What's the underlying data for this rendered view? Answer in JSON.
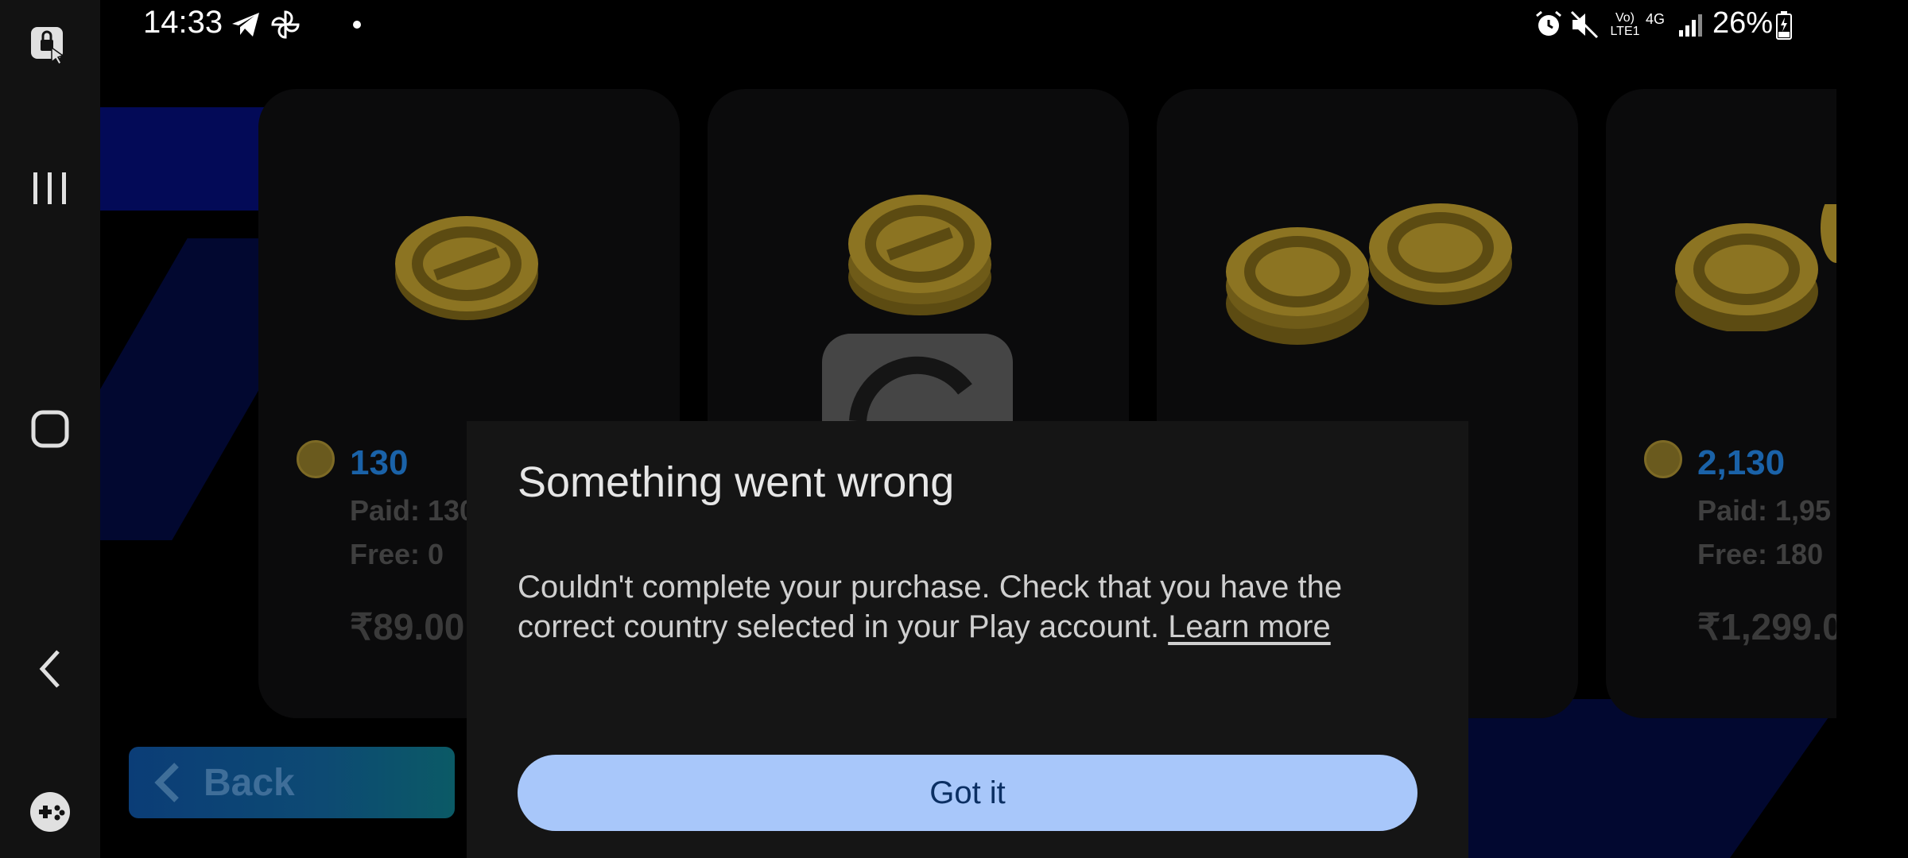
{
  "status_bar": {
    "time": "14:33",
    "battery": "26%",
    "network": "4G",
    "volte": "Vo) LTE1"
  },
  "nav_bar": {
    "icons": [
      "lock-touch-icon",
      "recents-icon",
      "home-icon",
      "back-arrow-icon",
      "game-launcher-icon"
    ]
  },
  "store": {
    "cards": [
      {
        "amount": "130",
        "paid": "Paid: 130",
        "free": "Free: 0",
        "price": "₹89.00"
      },
      {
        "amount": "",
        "paid": "",
        "free": "",
        "price": ""
      },
      {
        "amount": "",
        "paid": "",
        "free": "",
        "price": ""
      },
      {
        "amount": "2,130",
        "paid": "Paid: 1,95",
        "free": "Free: 180",
        "price": "₹1,299.0"
      }
    ],
    "back_label": "Back"
  },
  "dialog": {
    "title": "Something went wrong",
    "body": "Couldn't complete your purchase. Check that you have the correct country selected in your Play account.",
    "link": "Learn more",
    "button": "Got it"
  },
  "colors": {
    "dialog_bg": "#151515",
    "button_bg": "#a8c7fa",
    "button_text": "#0b2f63",
    "amount": "#1a62a8"
  }
}
